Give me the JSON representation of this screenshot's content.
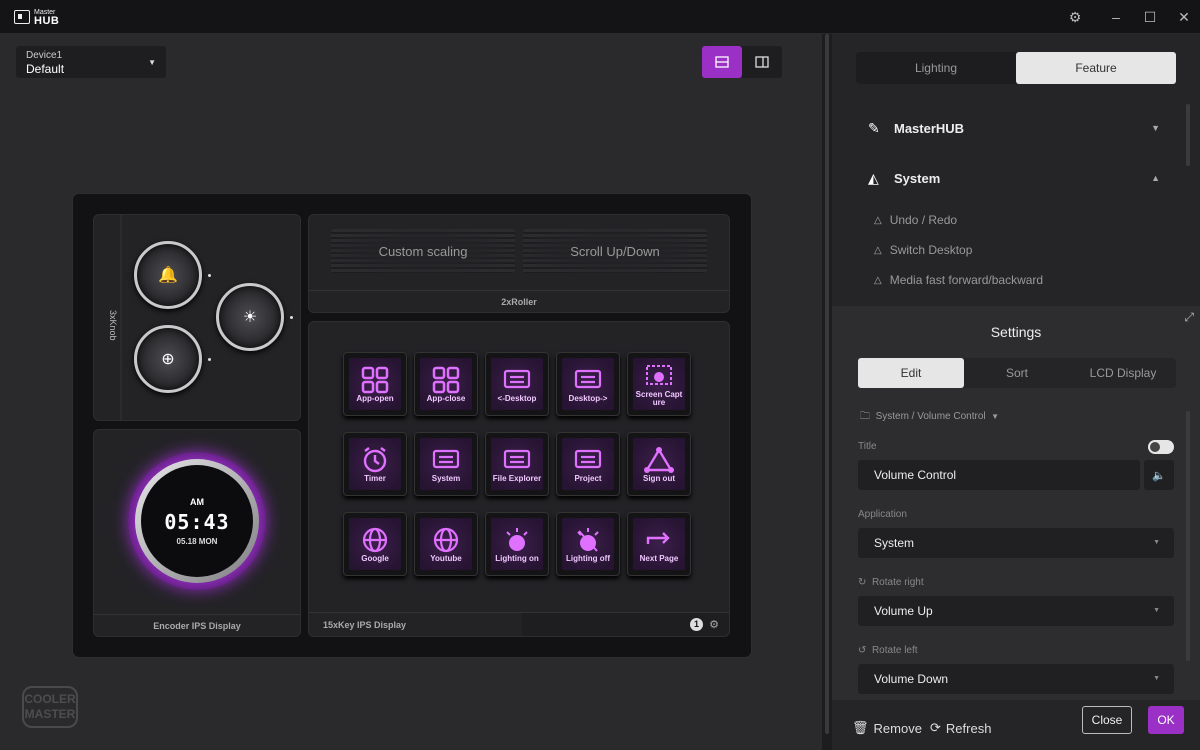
{
  "titlebar": {
    "logo_small": "Master",
    "logo_big": "HUB",
    "icons": [
      "gear-icon",
      "minimize-icon",
      "maximize-icon",
      "close-icon"
    ]
  },
  "device": {
    "name": "Device1",
    "profile": "Default"
  },
  "panels": {
    "knob_label": "3xKnob",
    "roller_label": "2xRoller",
    "rollers": [
      "Custom scaling",
      "Scroll Up/Down"
    ],
    "encoder_label": "Encoder IPS Display",
    "encoder": {
      "ampm": "AM",
      "time": "05:43",
      "date": "05.18 MON"
    },
    "keys_label": "15xKey IPS Display",
    "page": "1"
  },
  "keys": [
    {
      "label": "App-open",
      "icon": "grid-icon"
    },
    {
      "label": "App-close",
      "icon": "grid-icon"
    },
    {
      "label": "<-Desktop",
      "icon": "keyboard-icon"
    },
    {
      "label": "Desktop->",
      "icon": "keyboard-icon"
    },
    {
      "label": "Screen Capture",
      "icon": "camera-icon"
    },
    {
      "label": "Timer",
      "icon": "alarm-icon"
    },
    {
      "label": "System",
      "icon": "keyboard-icon"
    },
    {
      "label": "File Explorer",
      "icon": "keyboard-icon"
    },
    {
      "label": "Project",
      "icon": "keyboard-icon"
    },
    {
      "label": "Sign out",
      "icon": "triangle-icon"
    },
    {
      "label": "Google",
      "icon": "globe-icon"
    },
    {
      "label": "Youtube",
      "icon": "globe-icon"
    },
    {
      "label": "Lighting on",
      "icon": "sun-icon"
    },
    {
      "label": "Lighting off",
      "icon": "sun-off-icon"
    },
    {
      "label": "Next Page",
      "icon": "arrow-icon"
    }
  ],
  "brand": "COOLER MASTER",
  "right": {
    "tabs": [
      "Lighting",
      "Feature"
    ],
    "active_tab": "Feature",
    "categories": [
      {
        "label": "MasterHUB",
        "expanded": false
      },
      {
        "label": "System",
        "expanded": true
      }
    ],
    "subitems": [
      "Undo / Redo",
      "Switch Desktop",
      "Media fast forward/backward"
    ]
  },
  "settings": {
    "header": "Settings",
    "tabs": [
      "Edit",
      "Sort",
      "LCD Display"
    ],
    "active_tab": "Edit",
    "path": "System / Volume Control",
    "title_label": "Title",
    "title_value": "Volume Control",
    "application_label": "Application",
    "application_value": "System",
    "rotate_right_label": "Rotate right",
    "rotate_right_value": "Volume Up",
    "rotate_left_label": "Rotate left",
    "rotate_left_value": "Volume Down"
  },
  "footer": {
    "remove": "Remove",
    "refresh": "Refresh",
    "close": "Close",
    "ok": "OK"
  },
  "colors": {
    "accent": "#9a30c6",
    "key_glow": "#e070ff"
  }
}
